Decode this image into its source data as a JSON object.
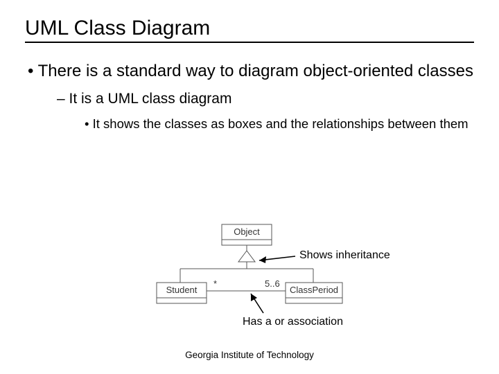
{
  "title": "UML Class Diagram",
  "bullet1": "There is a standard way to diagram object-oriented classes",
  "bullet2": "It is a UML class diagram",
  "bullet3": "It shows the classes as boxes and the relationships between them",
  "diagram": {
    "class_object": "Object",
    "class_student": "Student",
    "class_classperiod": "ClassPeriod",
    "mult_star": "*",
    "mult_range": "5..6",
    "annotation_inheritance": "Shows inheritance",
    "annotation_association": "Has a or association"
  },
  "footer": "Georgia Institute of Technology"
}
